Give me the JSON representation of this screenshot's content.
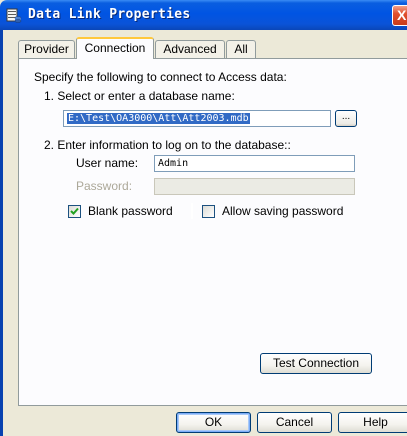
{
  "window": {
    "title": "Data Link Properties",
    "close_glyph": "X"
  },
  "tabs": [
    {
      "label": "Provider",
      "active": false
    },
    {
      "label": "Connection",
      "active": true
    },
    {
      "label": "Advanced",
      "active": false
    },
    {
      "label": "All",
      "active": false
    }
  ],
  "connection": {
    "intro": "Specify the following to connect to Access data:",
    "step1_label": "1. Select or enter a database name:",
    "database_path": "E:\\Test\\OA3000\\Att\\Att2003.mdb",
    "browse_label": "...",
    "step2_label": "2. Enter information to log on to the database::",
    "username_label": "User name:",
    "username_value": "Admin",
    "password_label": "Password:",
    "password_value": "",
    "blank_password_label": "Blank password",
    "blank_password_checked": true,
    "allow_saving_label": "Allow saving password",
    "allow_saving_checked": false,
    "test_connection_label": "Test Connection"
  },
  "buttons": {
    "ok": "OK",
    "cancel": "Cancel",
    "help": "Help"
  },
  "colors": {
    "titlebar": "#0054e3",
    "selection": "#316ac5",
    "check": "#21a121"
  },
  "icons": {
    "title": "data-link-icon",
    "check": "checkmark-icon"
  }
}
